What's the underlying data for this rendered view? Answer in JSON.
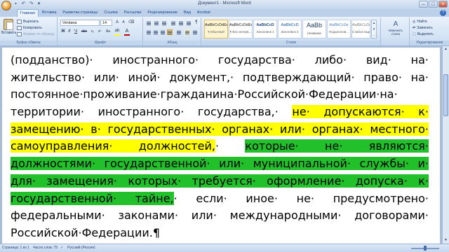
{
  "window": {
    "title": "Документ1 - Microsoft Word",
    "controls": [
      "–",
      "□",
      "×"
    ]
  },
  "qat": [
    "save-icon",
    "undo-icon",
    "redo-icon",
    "customize-icon"
  ],
  "tabs": [
    {
      "label": "Главная",
      "active": true
    },
    {
      "label": "Вставка"
    },
    {
      "label": "Разметка страницы"
    },
    {
      "label": "Ссылки"
    },
    {
      "label": "Рассылки"
    },
    {
      "label": "Рецензирование"
    },
    {
      "label": "Вид"
    },
    {
      "label": "Acrobat"
    }
  ],
  "ribbon": {
    "clipboard": {
      "label": "Буфер обмена",
      "paste": "Вставить",
      "cut": "Вырезать",
      "copy": "Копировать",
      "format_painter": "Формат по образцу"
    },
    "font": {
      "label": "Шрифт",
      "name": "Verdana",
      "size": "14",
      "buttons": [
        "Ж",
        "К",
        "Ч",
        "abc",
        "x₂",
        "x²",
        "Aa"
      ],
      "highlight_color": "#ffff00",
      "font_color": "#c00000"
    },
    "paragraph": {
      "label": "Абзац",
      "pilcrow": "¶"
    },
    "styles": {
      "label": "Стили",
      "items": [
        {
          "sample": "AaBbCcDdEe",
          "name": "¶ Обычный",
          "selected": true
        },
        {
          "sample": "AaBbCcDdEe",
          "name": "¶ Без интерв..."
        },
        {
          "sample": "AaBbCcD",
          "name": "Заголовок 1"
        },
        {
          "sample": "AaBbCcD",
          "name": "Заголовок 2"
        },
        {
          "sample": "AaBb",
          "name": "Название"
        },
        {
          "sample": "AaBbCcDe",
          "name": "Подзаголов..."
        },
        {
          "sample": "AaBbCcDd",
          "name": "Слабое выд..."
        }
      ],
      "change_styles": "Изменить стили"
    },
    "editing": {
      "label": "Редактирование",
      "find": "Найти",
      "replace": "Заменить",
      "select": "Выделить"
    }
  },
  "document": {
    "lines": [
      [
        {
          "t": "(подданство)· иностранного· государства· либо· вид· на·"
        }
      ],
      [
        {
          "t": "жительство· или· иной· документ,· подтверждающий· право· на·"
        }
      ],
      [
        {
          "t": "постоянное·проживание·гражданина·Российской·Федерации·на·"
        }
      ],
      [
        {
          "t": "территории· иностранного· государства,· "
        },
        {
          "t": "не· допускаются· к·",
          "hl": "yellow"
        }
      ],
      [
        {
          "t": "замещению· в· государственных· органах· или· органах· местного·",
          "hl": "yellow"
        }
      ],
      [
        {
          "t": "самоуправления· должностей,",
          "hl": "yellow"
        },
        {
          "t": "· "
        },
        {
          "t": "которые· не· являются·",
          "hl": "green"
        }
      ],
      [
        {
          "t": "должностями· государственной· или· муниципальной· службы· и·",
          "hl": "green"
        }
      ],
      [
        {
          "t": "для· замещения· которых· требуется· оформление· допуска· к·",
          "hl": "green"
        }
      ],
      [
        {
          "t": "государственной· тайне,",
          "hl": "green"
        },
        {
          "t": "· если· иное· не· предусмотрено·"
        }
      ],
      [
        {
          "t": "федеральными· законами· или· международными· договорами·"
        }
      ],
      [
        {
          "t": "Российской·Федерации.¶"
        }
      ]
    ]
  },
  "status": {
    "page": "Страница: 1 из 1",
    "words": "Число слов: 75",
    "language": "Русский (Россия)"
  }
}
